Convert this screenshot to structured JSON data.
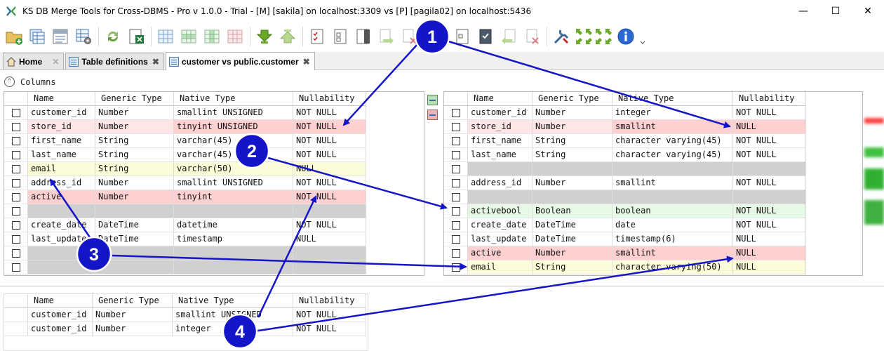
{
  "window": {
    "title": "KS DB Merge Tools for Cross-DBMS - Pro v 1.0.0 - Trial - [M] [sakila] on localhost:3309 vs [P] [pagila02] on localhost:5436",
    "minimize": "—",
    "maximize": "☐",
    "close": "✕"
  },
  "tabs": [
    {
      "label": "Home",
      "close": "✕"
    },
    {
      "label": "Table definitions",
      "close": "✖"
    },
    {
      "label": "customer vs public.customer",
      "close": "✖"
    }
  ],
  "section": {
    "title": "Columns",
    "toggle": "⌃"
  },
  "headers": [
    "Name",
    "Generic Type",
    "Native Type",
    "Nullability"
  ],
  "left_rows": [
    {
      "name": "customer_id",
      "generic": "Number",
      "native": "smallint UNSIGNED",
      "null": "NOT NULL",
      "status": "same"
    },
    {
      "name": "store_id",
      "generic": "Number",
      "native": "tinyint UNSIGNED",
      "null": "NOT NULL",
      "status": "diff"
    },
    {
      "name": "first_name",
      "generic": "String",
      "native": "varchar(45)",
      "null": "NOT NULL",
      "status": "same"
    },
    {
      "name": "last_name",
      "generic": "String",
      "native": "varchar(45)",
      "null": "NOT NULL",
      "status": "same"
    },
    {
      "name": "email",
      "generic": "String",
      "native": "varchar(50)",
      "null": "NULL",
      "status": "moved"
    },
    {
      "name": "address_id",
      "generic": "Number",
      "native": "smallint UNSIGNED",
      "null": "NOT NULL",
      "status": "same"
    },
    {
      "name": "active",
      "generic": "Number",
      "native": "tinyint",
      "null": "NOT NULL",
      "status": "diff"
    },
    {
      "name": "",
      "generic": "",
      "native": "",
      "null": "",
      "status": "empty"
    },
    {
      "name": "create_date",
      "generic": "DateTime",
      "native": "datetime",
      "null": "NOT NULL",
      "status": "same"
    },
    {
      "name": "last_update",
      "generic": "DateTime",
      "native": "timestamp",
      "null": "NULL",
      "status": "same"
    },
    {
      "name": "",
      "generic": "",
      "native": "",
      "null": "",
      "status": "empty"
    },
    {
      "name": "",
      "generic": "",
      "native": "",
      "null": "",
      "status": "empty"
    }
  ],
  "right_rows": [
    {
      "name": "customer_id",
      "generic": "Number",
      "native": "integer",
      "null": "NOT NULL",
      "status": "same"
    },
    {
      "name": "store_id",
      "generic": "Number",
      "native": "smallint",
      "null": "NULL",
      "status": "diff"
    },
    {
      "name": "first_name",
      "generic": "String",
      "native": "character varying(45)",
      "null": "NOT NULL",
      "status": "same"
    },
    {
      "name": "last_name",
      "generic": "String",
      "native": "character varying(45)",
      "null": "NOT NULL",
      "status": "same"
    },
    {
      "name": "",
      "generic": "",
      "native": "",
      "null": "",
      "status": "empty"
    },
    {
      "name": "address_id",
      "generic": "Number",
      "native": "smallint",
      "null": "NOT NULL",
      "status": "same"
    },
    {
      "name": "",
      "generic": "",
      "native": "",
      "null": "",
      "status": "empty"
    },
    {
      "name": "activebool",
      "generic": "Boolean",
      "native": "boolean",
      "null": "NOT NULL",
      "status": "added"
    },
    {
      "name": "create_date",
      "generic": "DateTime",
      "native": "date",
      "null": "NOT NULL",
      "status": "same"
    },
    {
      "name": "last_update",
      "generic": "DateTime",
      "native": "timestamp(6)",
      "null": "NULL",
      "status": "same"
    },
    {
      "name": "active",
      "generic": "Number",
      "native": "smallint",
      "null": "NULL",
      "status": "diff"
    },
    {
      "name": "email",
      "generic": "String",
      "native": "character varying(50)",
      "null": "NULL",
      "status": "moved"
    }
  ],
  "bottom_rows": [
    {
      "name": "customer_id",
      "generic": "Number",
      "native": "smallint UNSIGNED",
      "null": "NOT NULL"
    },
    {
      "name": "customer_id",
      "generic": "Number",
      "native": "integer",
      "null": "NOT NULL"
    }
  ],
  "callouts": [
    "1",
    "2",
    "3",
    "4"
  ],
  "colors": {
    "diff": "#ffd0d0",
    "moved": "#fdfcd8",
    "added": "#e6f8e6",
    "empty": "#d0d0d0",
    "callout": "#1414c8"
  }
}
